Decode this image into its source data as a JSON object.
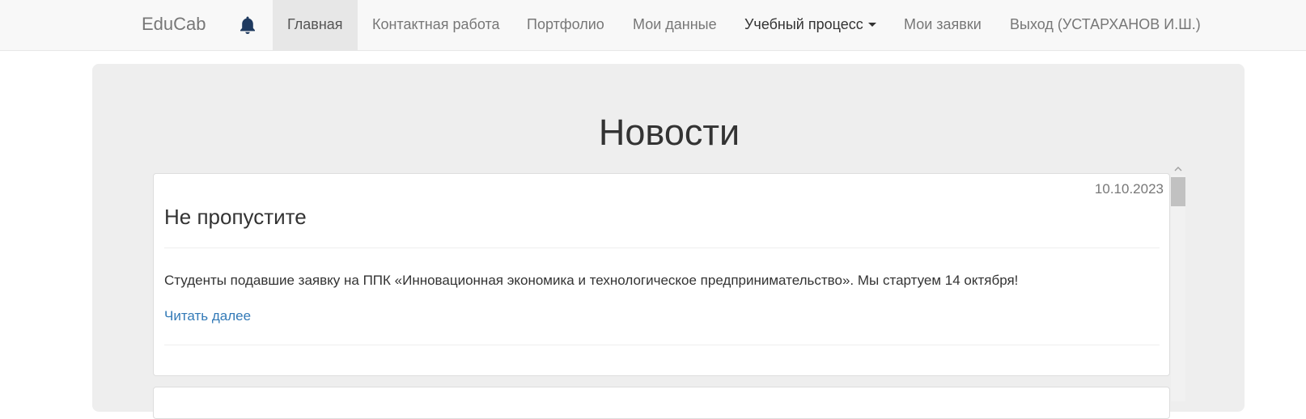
{
  "navbar": {
    "brand": "EduCab",
    "bell_icon": "bell-icon",
    "items": [
      {
        "label": "Главная"
      },
      {
        "label": "Контактная работа"
      },
      {
        "label": "Портфолио"
      },
      {
        "label": "Мои данные"
      },
      {
        "label": "Учебный процесс"
      },
      {
        "label": "Мои заявки"
      },
      {
        "label": "Выход (УСТАРХАНОВ И.Ш.)"
      }
    ],
    "active_item": "Главная",
    "bell_color": "#1f3a5f"
  },
  "main": {
    "title": "Новости",
    "news": [
      {
        "date": "10.10.2023",
        "title": "Не пропустите",
        "body": "Студенты подавшие заявку на ППК «Инновационная экономика и технологическое предпринимательство». Мы стартуем 14 октября!",
        "link": "Читать далее"
      }
    ]
  },
  "colors": {
    "link": "#337ab7",
    "navbar_bg": "#f8f8f8",
    "jumbotron_bg": "#eeeeee"
  }
}
